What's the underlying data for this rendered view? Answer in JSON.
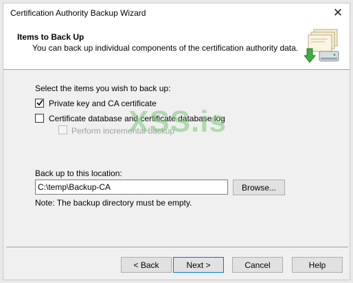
{
  "window": {
    "title": "Certification Authority Backup Wizard",
    "close_glyph": "✕"
  },
  "header": {
    "title": "Items to Back Up",
    "subtitle": "You can back up individual components of the certification authority data."
  },
  "content": {
    "select_prompt": "Select the items you wish to back up:",
    "items": [
      {
        "label": "Private key and CA certificate",
        "checked": true,
        "enabled": true
      },
      {
        "label": "Certificate database and certificate database log",
        "checked": false,
        "enabled": true
      },
      {
        "label": "Perform incremental backup",
        "checked": false,
        "enabled": false
      }
    ],
    "location_label": "Back up to this location:",
    "location_value": "C:\\temp\\Backup-CA",
    "browse_label": "Browse...",
    "note": "Note: The backup directory must be empty."
  },
  "watermark": "XSS.is",
  "footer": {
    "back_label": "< Back",
    "next_label": "Next >",
    "cancel_label": "Cancel",
    "help_label": "Help"
  },
  "colors": {
    "focus_border": "#0078d7",
    "watermark": "#78c878"
  }
}
